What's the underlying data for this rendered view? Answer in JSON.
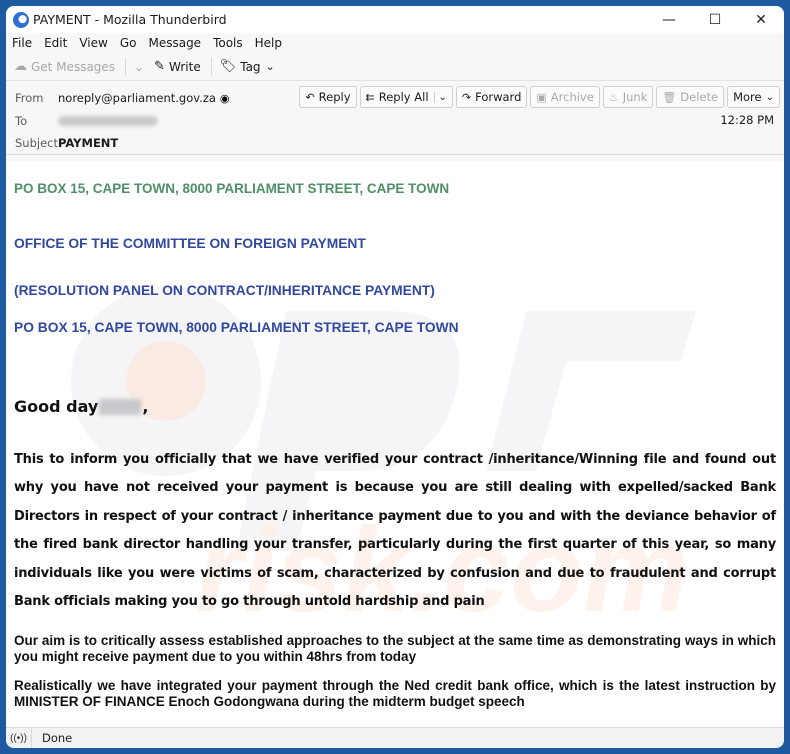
{
  "window": {
    "title": "PAYMENT - Mozilla Thunderbird",
    "controls": {
      "minimize": "—",
      "maximize": "☐",
      "close": "✕"
    }
  },
  "menu": [
    "File",
    "Edit",
    "View",
    "Go",
    "Message",
    "Tools",
    "Help"
  ],
  "toolbar": {
    "get_messages": "Get Messages",
    "write": "Write",
    "tag": "Tag"
  },
  "header": {
    "from_label": "From",
    "from_value": "noreply@parliament.gov.za",
    "to_label": "To",
    "subject_label": "Subject",
    "subject_value": "PAYMENT",
    "time": "12:28 PM",
    "actions": {
      "reply": "Reply",
      "reply_all": "Reply All",
      "forward": "Forward",
      "archive": "Archive",
      "junk": "Junk",
      "delete": "Delete",
      "more": "More"
    }
  },
  "message": {
    "address_green": "PO BOX 15, CAPE TOWN, 8000 PARLIAMENT STREET, CAPE TOWN",
    "office": "OFFICE OF THE COMMITTEE ON FOREIGN PAYMENT",
    "panel": "(RESOLUTION PANEL ON CONTRACT/INHERITANCE PAYMENT)",
    "address_blue": "PO BOX 15, CAPE TOWN, 8000 PARLIAMENT STREET, CAPE TOWN",
    "greeting": "Good day",
    "greeting_suffix": ",",
    "paragraph1": "This to inform you officially that we have verified your contract /inheritance/Winning file and found out why you have not received your payment is because you are still dealing with expelled/sacked Bank Directors in respect of your contract / inheritance payment due to you and with the deviance behavior of the fired bank director handling your transfer, particularly during the first quarter of this year, so many individuals like you were victims of scam, characterized by confusion and due to fraudulent and corrupt Bank officials making you to go through untold hardship and pain",
    "paragraph2": "Our aim is to critically assess established approaches to the subject at the same time as demonstrating ways in which you might receive payment due to you within 48hrs from today",
    "paragraph3": "Realistically we have integrated your payment through the Ned credit bank office, which is the latest instruction by MINISTER OF FINANCE Enoch Godongwana during the midterm budget speech"
  },
  "status": {
    "text": "Done"
  },
  "colors": {
    "frame": "#1f5aa0",
    "heading_green": "#4f8f67",
    "heading_blue": "#3148a0"
  }
}
